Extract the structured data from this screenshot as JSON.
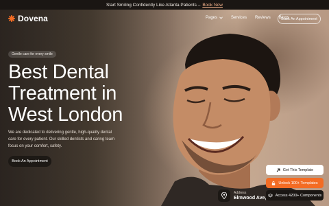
{
  "announcement": {
    "text": "Start Smiling Confidently Like Atlanta Patients –",
    "link": "Book Now"
  },
  "brand": {
    "name": "Dovena",
    "accent": "#f36c24"
  },
  "nav": {
    "items": [
      {
        "label": "Pages",
        "has_dropdown": true
      },
      {
        "label": "Services"
      },
      {
        "label": "Reviews"
      },
      {
        "label": "Blogs"
      }
    ],
    "cta": "Book An Appointment"
  },
  "hero": {
    "tag": "Gentle care for every smile",
    "title_lines": [
      "Best Dental",
      "Treatment in",
      "West London"
    ],
    "description": "We are dedicated to delivering gentle, high-quality dental care for every patient. Our skilled dentists and caring team focus on your comfort, safety.",
    "cta": "Book An Appointment"
  },
  "address": {
    "label": "Address",
    "value": "Elmwood Ave,"
  },
  "floating_buttons": [
    {
      "label": "Get This Template",
      "icon": "arrow-up-right-icon"
    },
    {
      "label": "Unlock 100+ Templates",
      "icon": "unlock-icon"
    },
    {
      "label": "Access 4200+ Components",
      "icon": "layers-icon"
    }
  ]
}
